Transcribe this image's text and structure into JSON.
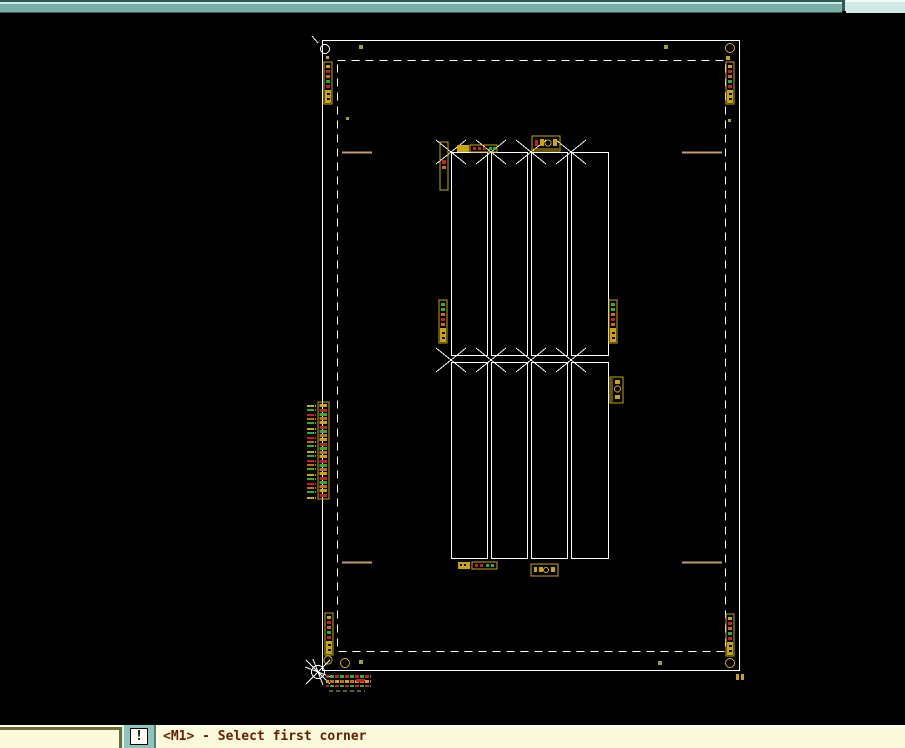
{
  "status_bar": {
    "alert_button_label": "!",
    "message": "<M1> - Select first corner"
  },
  "colors": {
    "canvas_black": "#000000",
    "titlebar_teal_dark": "#2f5a55",
    "titlebar_teal_mid": "#79b1a9",
    "titlebar_teal_light": "#cfe9e6",
    "divider_teal": "#8fc4bc",
    "panel_cream": "#fbfbdc",
    "panel_border_olive": "#6b6b3a",
    "status_text_maroon": "#6e1a00",
    "board_white": "#ffffff",
    "silk_yellow": "#c9a60a",
    "silk_olive": "#9aa03c",
    "pin_red": "#c42222",
    "pin_orange": "#c96c12",
    "pin_green": "#2fae2f",
    "dim_olive": "#5f5f22",
    "fiducial_tan": "#c49a6c"
  }
}
